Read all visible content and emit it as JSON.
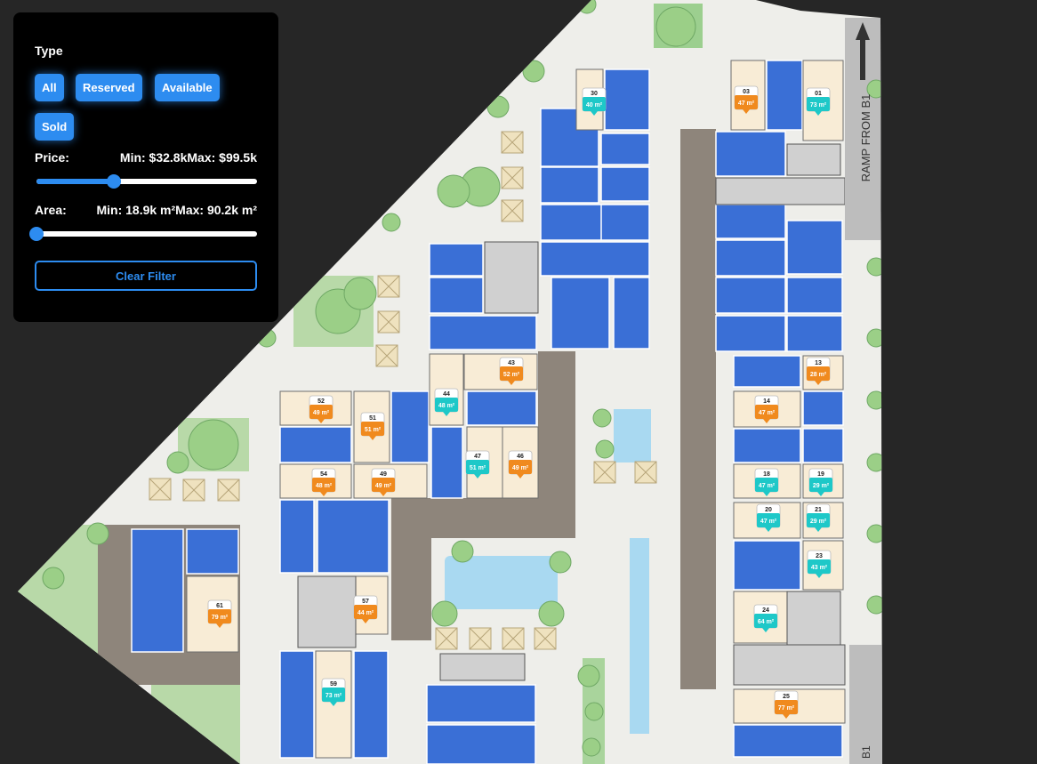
{
  "filter_panel": {
    "type_label": "Type",
    "type_buttons": [
      "All",
      "Reserved",
      "Available",
      "Sold"
    ],
    "price": {
      "label": "Price:",
      "min_text": "Min: $32.8k",
      "max_text": "Max: $99.5k",
      "slider_fraction": 0.35
    },
    "area": {
      "label": "Area:",
      "min_text": "Min: 18.9k m²",
      "max_text": "Max: 90.2k m²",
      "slider_fraction": 0.0
    },
    "clear_label": "Clear Filter"
  },
  "map": {
    "ramp_label": "RAMP FROM B1",
    "ramp_label_bottom": "B1",
    "colors": {
      "unit_blue": "#3a6fd6",
      "available_teal": "#1ec8c8",
      "reserved_orange": "#f08a1e",
      "unit_cream": "#f8ecd6",
      "grass": "#93c98a",
      "pool": "#a9d9f1",
      "deck": "#8a7f74"
    },
    "units": [
      {
        "num": "30",
        "area": "40 m²",
        "status": "available"
      },
      {
        "num": "03",
        "area": "47 m²",
        "status": "reserved"
      },
      {
        "num": "01",
        "area": "73 m²",
        "status": "available"
      },
      {
        "num": "43",
        "area": "52 m²",
        "status": "reserved"
      },
      {
        "num": "13",
        "area": "28 m²",
        "status": "reserved"
      },
      {
        "num": "44",
        "area": "48 m²",
        "status": "available"
      },
      {
        "num": "52",
        "area": "49 m²",
        "status": "reserved"
      },
      {
        "num": "51",
        "area": "51 m²",
        "status": "reserved"
      },
      {
        "num": "14",
        "area": "47 m²",
        "status": "reserved"
      },
      {
        "num": "47",
        "area": "51 m²",
        "status": "available"
      },
      {
        "num": "46",
        "area": "49 m²",
        "status": "reserved"
      },
      {
        "num": "54",
        "area": "48 m²",
        "status": "reserved"
      },
      {
        "num": "49",
        "area": "49 m²",
        "status": "reserved"
      },
      {
        "num": "18",
        "area": "47 m²",
        "status": "available"
      },
      {
        "num": "19",
        "area": "29 m²",
        "status": "available"
      },
      {
        "num": "20",
        "area": "47 m²",
        "status": "available"
      },
      {
        "num": "21",
        "area": "29 m²",
        "status": "available"
      },
      {
        "num": "23",
        "area": "43 m²",
        "status": "available"
      },
      {
        "num": "61",
        "area": "79 m²",
        "status": "reserved"
      },
      {
        "num": "57",
        "area": "44 m²",
        "status": "reserved"
      },
      {
        "num": "24",
        "area": "64 m²",
        "status": "available"
      },
      {
        "num": "59",
        "area": "73 m²",
        "status": "available"
      },
      {
        "num": "25",
        "area": "77 m²",
        "status": "reserved"
      }
    ]
  }
}
